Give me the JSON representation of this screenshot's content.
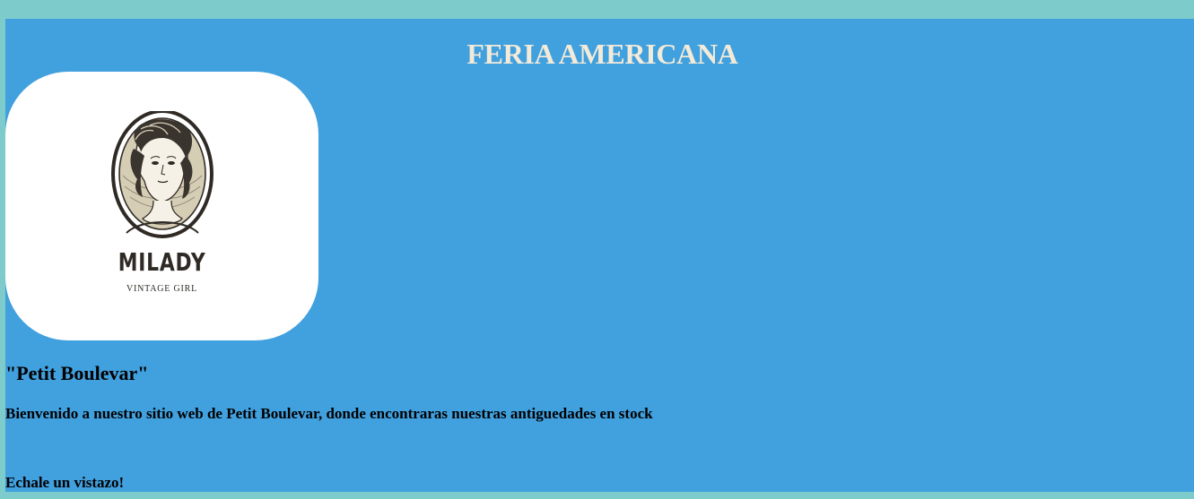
{
  "header": {
    "title": "FERIA AMERICANA"
  },
  "logo": {
    "name": "MILADY",
    "subtitle": "VINTAGE GIRL",
    "icon": "woman-portrait-cameo-icon"
  },
  "main": {
    "store_name": "\"Petit Boulevar\"",
    "welcome_text": "Bienvenido a nuestro sitio web de Petit Boulevar, donde encontraras nuestras antiguedades en stock",
    "cta_text": "Echale un vistazo!"
  },
  "colors": {
    "outer_background": "#7ecbcb",
    "panel_background": "#41a0de",
    "title_text": "#f3ead8",
    "logo_card": "#ffffff",
    "logo_ink": "#2f2a25",
    "body_text": "#000000"
  }
}
